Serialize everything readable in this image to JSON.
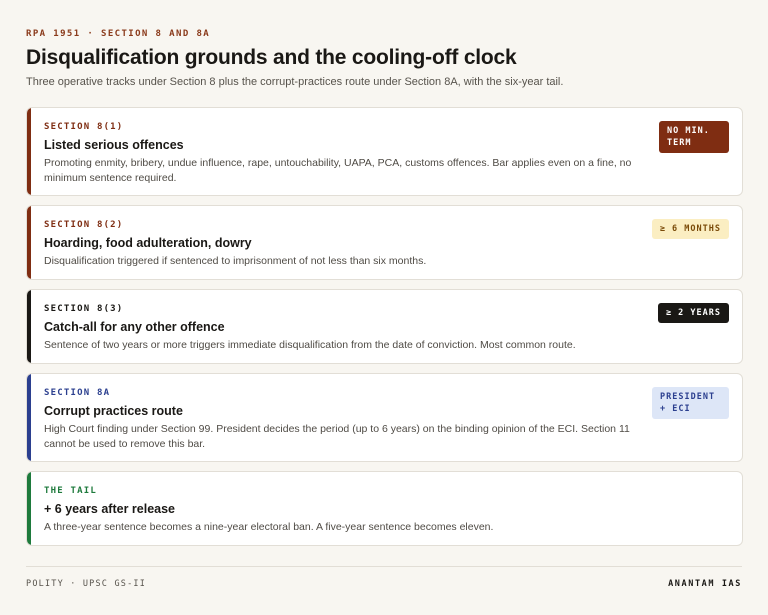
{
  "header": {
    "eyebrow": "RPA 1951 · SECTION 8 AND 8A",
    "title": "Disqualification grounds and the cooling-off clock",
    "subtitle": "Three operative tracks under Section 8 plus the corrupt-practices route under Section 8A, with the six-year tail."
  },
  "cards": [
    {
      "label": "SECTION 8(1)",
      "heading": "Listed serious offences",
      "description": "Promoting enmity, bribery, undue influence, rape, untouchability, UAPA, PCA, customs offences. Bar applies even on a fine, no minimum sentence required.",
      "badge": "NO MIN. TERM",
      "accent_color": "#7f2d12"
    },
    {
      "label": "SECTION 8(2)",
      "heading": "Hoarding, food adulteration, dowry",
      "description": "Disqualification triggered if sentenced to imprisonment of not less than six months.",
      "badge": "≥ 6 MONTHS",
      "accent_color": "#7f2d12"
    },
    {
      "label": "SECTION 8(3)",
      "heading": "Catch-all for any other offence",
      "description": "Sentence of two years or more triggers immediate disqualification from the date of conviction. Most common route.",
      "badge": "≥ 2 YEARS",
      "accent_color": "#1a1815"
    },
    {
      "label": "SECTION 8A",
      "heading": "Corrupt practices route",
      "description": "High Court finding under Section 99. President decides the period (up to 6 years) on the binding opinion of the ECI. Section 11 cannot be used to remove this bar.",
      "badge": "PRESIDENT + ECI",
      "accent_color": "#2b3f8f"
    },
    {
      "label": "THE TAIL",
      "heading": "+ 6 years after release",
      "description": "A three-year sentence becomes a nine-year electoral ban. A five-year sentence becomes eleven.",
      "badge": "",
      "accent_color": "#1e7a3c"
    }
  ],
  "footer": {
    "left": "POLITY · UPSC GS-II",
    "right": "ANANTAM IAS"
  }
}
